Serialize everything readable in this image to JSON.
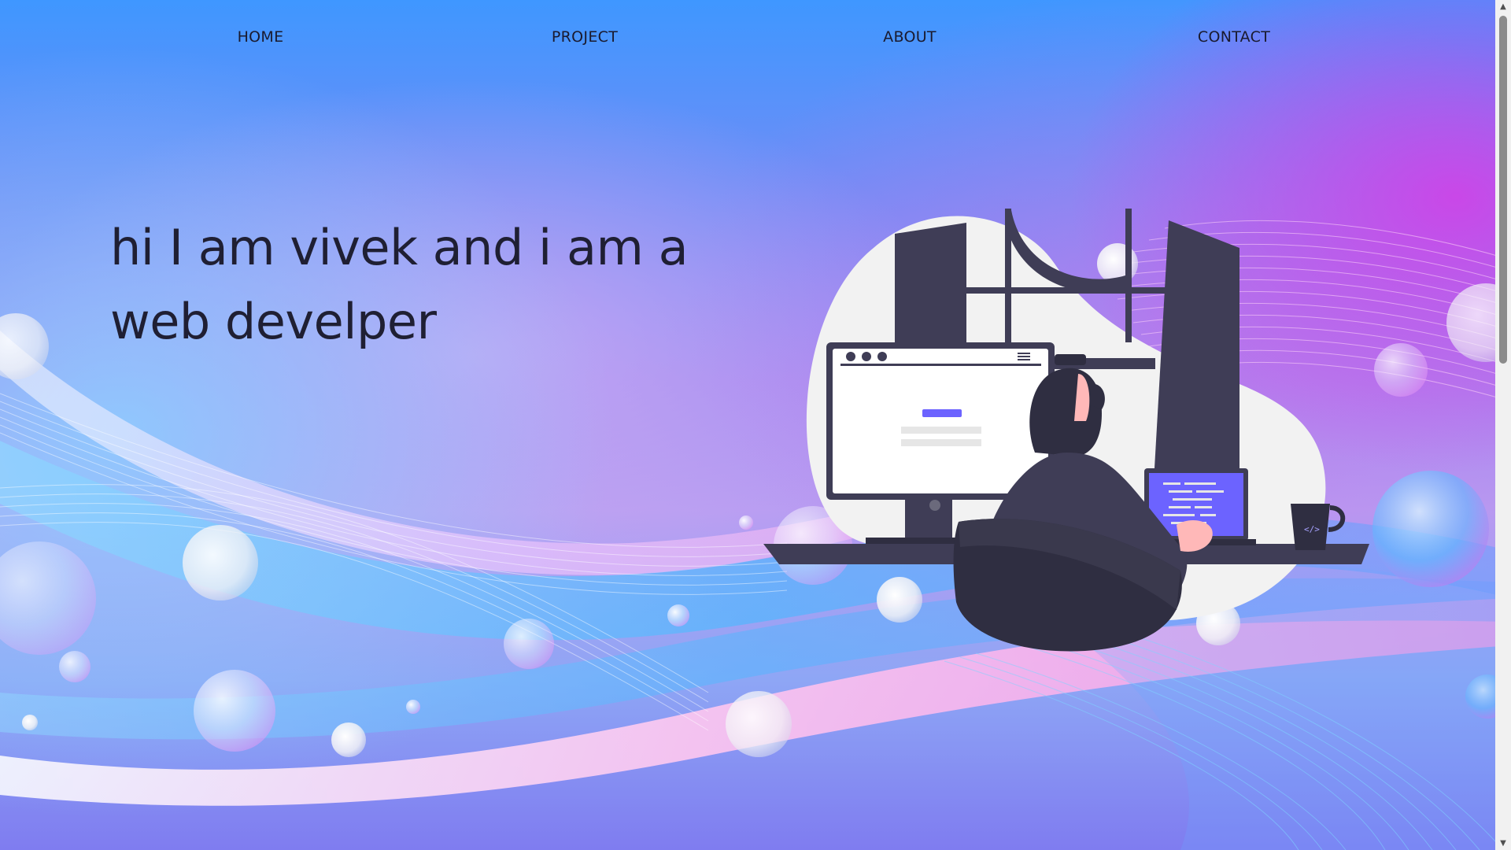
{
  "nav": {
    "home": "HOME",
    "project": "PROJECT",
    "about": "ABOUT",
    "contact": "CONTACT"
  },
  "hero": {
    "line1": "hi I am vivek and i am a",
    "line2": "web develper"
  },
  "illustration": {
    "subject": "developer-at-desk",
    "laptop_code_glyph": "</>"
  },
  "colors": {
    "text": "#1f1f33",
    "accent": "#6c63ff",
    "dark_figure": "#3f3d56",
    "blob": "#f2f2f2"
  },
  "scrollbar": {
    "up_icon": "▲",
    "down_icon": "▼"
  }
}
